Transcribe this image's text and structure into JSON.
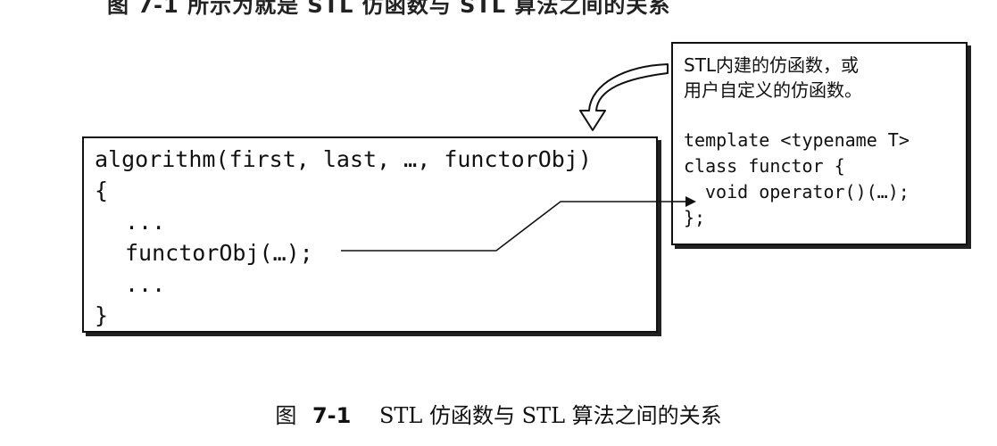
{
  "algorithm_box": {
    "lines": [
      "algorithm(first, last, …, functorObj)",
      "{",
      "...",
      "functorObj(…);",
      "...",
      "}"
    ]
  },
  "functor_box": {
    "note_line1": "STL内建的仿函数，或",
    "note_line2": "用户自定义的仿函数。",
    "code_lines": [
      "template <typename T>",
      "class functor {",
      "void operator()(…);",
      "};"
    ]
  },
  "caption": {
    "prefix": "图",
    "number": "7-1",
    "text": "STL 仿函数与 STL 算法之间的关系"
  }
}
